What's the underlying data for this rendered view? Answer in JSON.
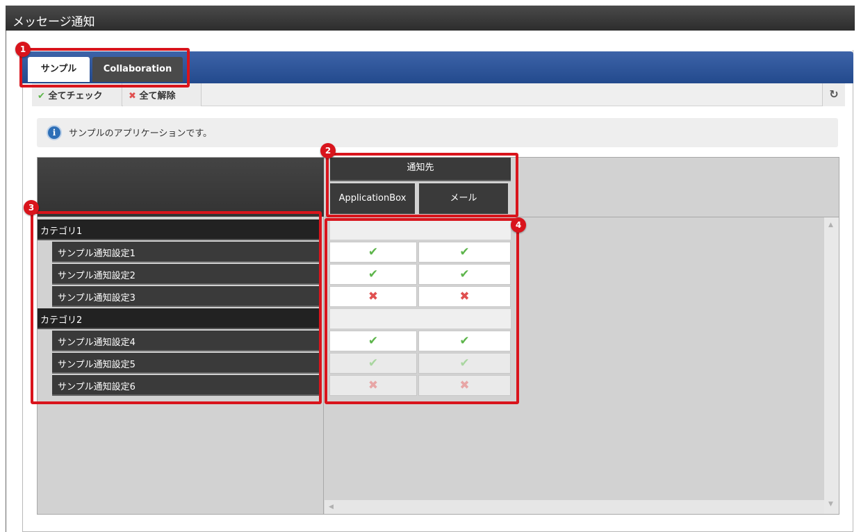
{
  "window": {
    "title": "メッセージ通知"
  },
  "tabs": [
    {
      "label": "サンプル",
      "active": true
    },
    {
      "label": "Collaboration",
      "active": false
    }
  ],
  "toolbar": {
    "check_all": "全てチェック",
    "uncheck_all": "全て解除",
    "refresh_icon": "refresh-icon"
  },
  "info": {
    "message": "サンプルのアプリケーションです。"
  },
  "table": {
    "group_header": "通知先",
    "columns": [
      "ApplicationBox",
      "メール"
    ],
    "categories": [
      {
        "name": "カテゴリ1",
        "items": [
          {
            "label": "サンプル通知設定1",
            "values": [
              "check",
              "check"
            ],
            "enabled": true
          },
          {
            "label": "サンプル通知設定2",
            "values": [
              "check",
              "check"
            ],
            "enabled": true
          },
          {
            "label": "サンプル通知設定3",
            "values": [
              "cross",
              "cross"
            ],
            "enabled": true
          }
        ]
      },
      {
        "name": "カテゴリ2",
        "items": [
          {
            "label": "サンプル通知設定4",
            "values": [
              "check",
              "check"
            ],
            "enabled": true
          },
          {
            "label": "サンプル通知設定5",
            "values": [
              "check",
              "check"
            ],
            "enabled": false
          },
          {
            "label": "サンプル通知設定6",
            "values": [
              "cross",
              "cross"
            ],
            "enabled": false
          }
        ]
      }
    ]
  },
  "glyphs": {
    "check": "✔",
    "cross": "✖",
    "info": "i",
    "refresh": "↻",
    "arrow_up": "▲",
    "arrow_down": "▼",
    "arrow_left": "◀"
  },
  "callouts": [
    "1",
    "2",
    "3",
    "4"
  ],
  "colors": {
    "callout": "#d9141c",
    "tabbar": "#2f559a",
    "check": "#5db54b",
    "cross": "#d84040"
  }
}
